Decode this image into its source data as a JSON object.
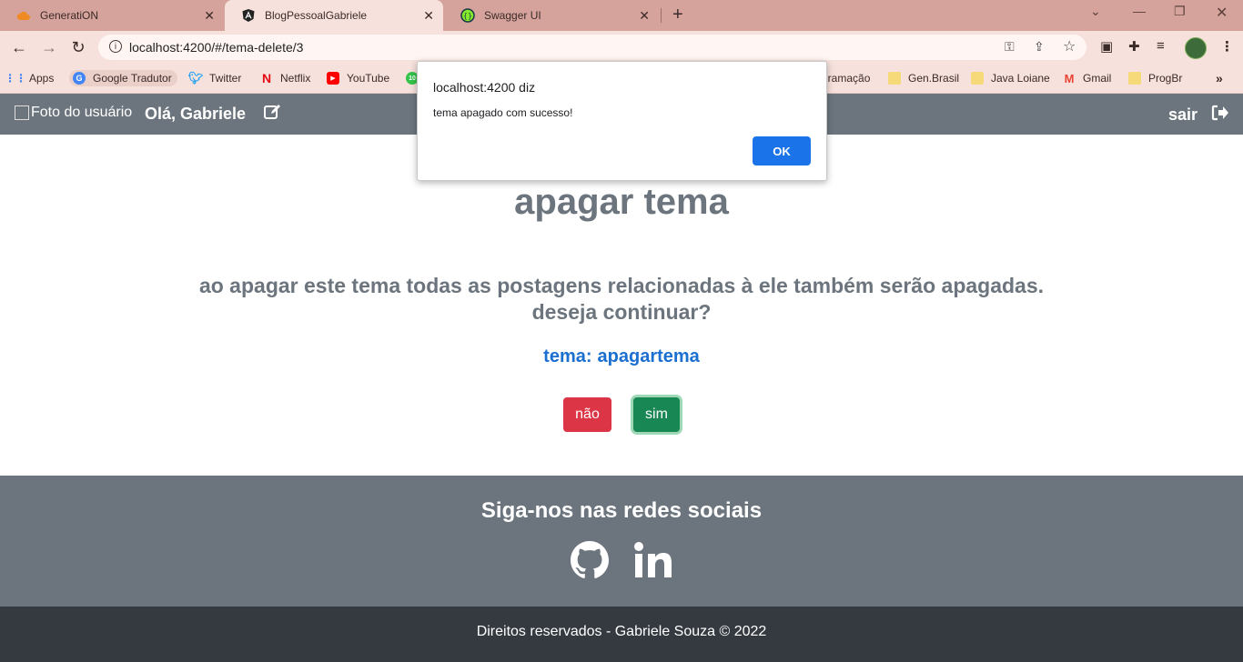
{
  "browser": {
    "tabs": [
      {
        "label": "GeneratiON",
        "icon": "cloud-icon"
      },
      {
        "label": "BlogPessoalGabriele",
        "icon": "angular-icon"
      },
      {
        "label": "Swagger UI",
        "icon": "swagger-icon"
      }
    ],
    "url": "localhost:4200/#/tema-delete/3",
    "bookmarks": [
      {
        "label": "Apps"
      },
      {
        "label": "Google Tradutor"
      },
      {
        "label": "Twitter"
      },
      {
        "label": "Netflix"
      },
      {
        "label": "YouTube"
      },
      {
        "label": "gramação"
      },
      {
        "label": "Gen.Brasil"
      },
      {
        "label": "Java Loiane"
      },
      {
        "label": "Gmail"
      },
      {
        "label": "ProgBr"
      }
    ]
  },
  "navbar": {
    "photo_alt": "Foto do usuário",
    "greeting": "Olá, Gabriele",
    "logout": "sair"
  },
  "main": {
    "title": "apagar tema",
    "warning": "ao apagar este tema todas as postagens relacionadas à ele também serão apagadas. deseja continuar?",
    "tema_label": "tema:",
    "tema_value": "apagartema",
    "btn_no": "não",
    "btn_yes": "sim"
  },
  "footer": {
    "heading": "Siga-nos nas redes sociais",
    "copyright": "Direitos reservados - Gabriele Souza © 2022"
  },
  "alert": {
    "origin": "localhost:4200 diz",
    "message": "tema apagado com sucesso!",
    "ok": "OK"
  },
  "colors": {
    "navbar": "#6c757d",
    "footer_bottom": "#343a40",
    "danger": "#dc3545",
    "success": "#198754",
    "accent": "#1b6fd1"
  }
}
